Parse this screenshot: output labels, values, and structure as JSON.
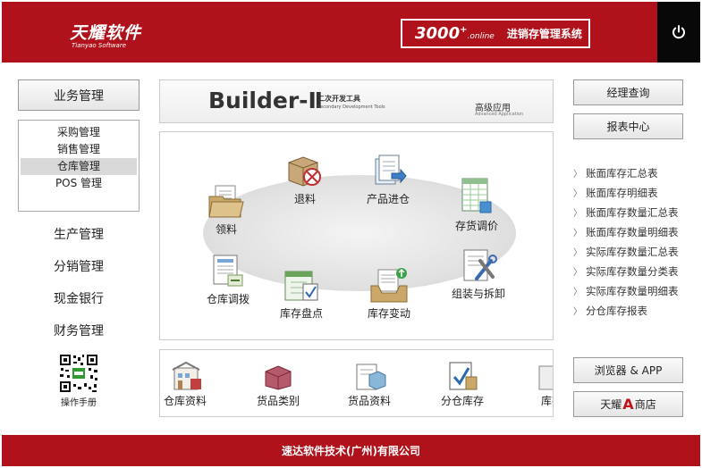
{
  "header": {
    "brand_name": "天耀软件",
    "brand_sub": "Tianyao Software",
    "product_num": "3000",
    "product_suffix": ".online",
    "product_name": "进销存管理系统"
  },
  "left": {
    "business_label": "业务管理",
    "submenu": [
      "采购管理",
      "销售管理",
      "仓库管理",
      "POS 管理"
    ],
    "active_submenu": "仓库管理",
    "menus": [
      "生产管理",
      "分销管理",
      "现金银行",
      "财务管理"
    ],
    "manual_label": "操作手册"
  },
  "banner": {
    "title": "Builder-Ⅱ",
    "subtitle_cn": "二次开发工具",
    "subtitle_en": "Secondary Development Tools",
    "right_cn": "高级应用",
    "right_en": "Advanced Application"
  },
  "flow": {
    "items": [
      "领料",
      "退料",
      "产品进仓",
      "存货调价",
      "仓库调拨",
      "库存盘点",
      "库存变动",
      "组装与拆卸"
    ]
  },
  "bottom": {
    "items": [
      "仓库资料",
      "货品类别",
      "货品资料",
      "分仓库存",
      "库存"
    ]
  },
  "right": {
    "manager_query": "经理查询",
    "report_center": "报表中心",
    "reports": [
      "账面库存汇总表",
      "账面库存明细表",
      "账面库存数量汇总表",
      "账面库存数量明细表",
      "实际库存数量汇总表",
      "实际库存数量分类表",
      "实际库存数量明细表",
      "分仓库存报表"
    ],
    "browser_app": "浏览器 & APP",
    "store_pre": "天耀",
    "store_a": "A",
    "store_post": "商店"
  },
  "footer": {
    "company": "速达软件技术(广州)有限公司"
  },
  "colors": {
    "brand_red": "#b0121b",
    "power_bg": "#080808"
  }
}
